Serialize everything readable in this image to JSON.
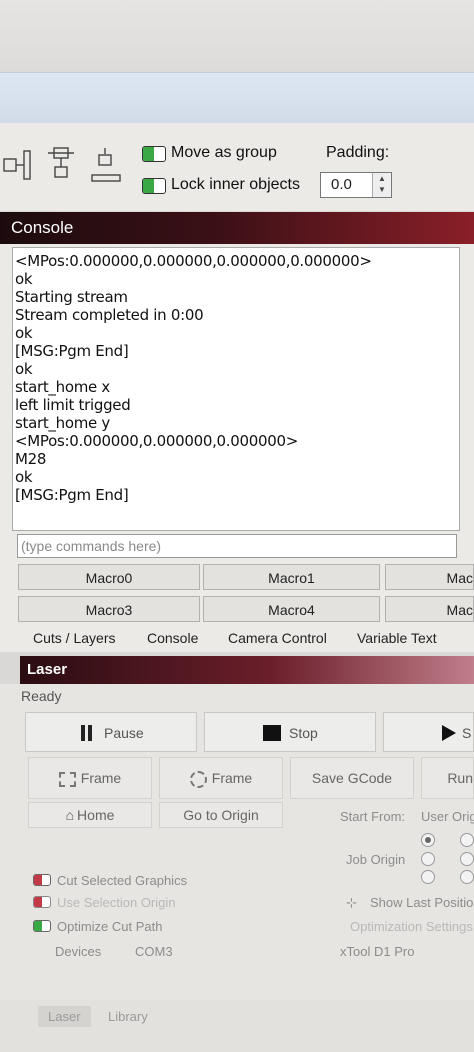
{
  "toolbar": {
    "move_as_group": "Move as group",
    "lock_inner_objects": "Lock inner objects",
    "padding_label": "Padding:",
    "padding_value": "0.0"
  },
  "console": {
    "title": "Console",
    "lines": [
      "<MPos:0.000000,0.000000,0.000000,0.000000>",
      "ok",
      "Starting stream",
      "Stream completed in 0:00",
      "ok",
      "[MSG:Pgm End]",
      "ok",
      "start_home x",
      "left limit trigged",
      "start_home y",
      " <MPos:0.000000,0.000000,0.000000>",
      " M28",
      " ok",
      " [MSG:Pgm End]"
    ],
    "input_placeholder": "(type commands here)",
    "macros_row1": [
      "Macro0",
      "Macro1",
      "Mac"
    ],
    "macros_row2": [
      "Macro3",
      "Macro4",
      "Mac"
    ]
  },
  "tabs": [
    "Cuts / Layers",
    "Console",
    "Camera Control",
    "Variable Text"
  ],
  "laser": {
    "title": "Laser",
    "status": "Ready",
    "pause": "Pause",
    "stop": "Stop",
    "start": "S",
    "frame1": "Frame",
    "frame2": "Frame",
    "save_gcode": "Save GCode",
    "run": "Run",
    "home": "Home",
    "go_to_origin": "Go to Origin",
    "start_from_label": "Start From:",
    "start_from_value": "User Orig",
    "job_origin_label": "Job Origin",
    "cut_selected_graphics": "Cut Selected Graphics",
    "use_selection_origin": "Use Selection Origin",
    "optimize_cut_path": "Optimize Cut Path",
    "show_last_position": "Show Last Position",
    "optimization_settings": "Optimization Settings",
    "devices_label": "Devices",
    "port": "COM3",
    "device_name": "xTool D1 Pro"
  },
  "bottom_tabs": [
    "Laser",
    "Library"
  ],
  "colors": {
    "console_header_dark": "#1c0b0e",
    "console_header_red": "#8a1f28",
    "toggle_on": "#3aa845",
    "toggle_off": "#c23a45"
  }
}
